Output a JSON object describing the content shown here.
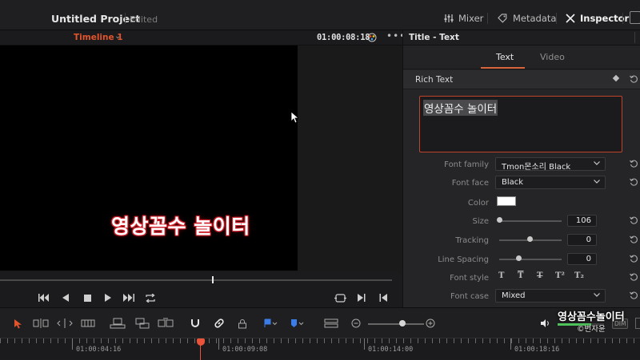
{
  "app": {
    "project_title": "Untitled Project",
    "project_status": "Edited"
  },
  "top_tabs": [
    {
      "label": "Mixer",
      "icon": "mixer-icon"
    },
    {
      "label": "Metadata",
      "icon": "metadata-tag-icon"
    },
    {
      "label": "Inspector",
      "icon": "inspector-icon",
      "active": true
    }
  ],
  "viewer": {
    "timeline_name": "Timeline 1",
    "timecode": "01:00:08:18",
    "overlay_text": "영상꼼수 놀이터"
  },
  "inspector": {
    "title": "Title - Text",
    "tabs": [
      {
        "label": "Text",
        "active": true
      },
      {
        "label": "Video",
        "active": false
      }
    ],
    "section_title": "Rich Text",
    "rich_text_value": "영상꼼수 놀이터",
    "font_family_label": "Font family",
    "font_family_value": "Tmon몬소리 Black",
    "font_face_label": "Font face",
    "font_face_value": "Black",
    "color_label": "Color",
    "color_value": "#ffffff",
    "size_label": "Size",
    "size_value": "106",
    "tracking_label": "Tracking",
    "tracking_value": "0",
    "line_spacing_label": "Line Spacing",
    "line_spacing_value": "0",
    "font_style_label": "Font style",
    "font_style_buttons": [
      "T",
      "T",
      "T",
      "T²",
      "T₂"
    ],
    "font_case_label": "Font case",
    "font_case_value": "Mixed"
  },
  "timeline_ruler": {
    "labels": [
      "01:00:04:16",
      "01:00:09:08",
      "01:00:14:00",
      "01:00:18:16"
    ]
  },
  "watermark": {
    "title": "영상꼼수놀이터",
    "credit": "©번자윤"
  },
  "audio": {
    "dim_label": "DIM",
    "meter_level": 0.72
  },
  "colors": {
    "accent": "#e0542c",
    "text_glow": "#d0202a",
    "playhead": "#e8533a",
    "meter": "#4fc35b"
  }
}
